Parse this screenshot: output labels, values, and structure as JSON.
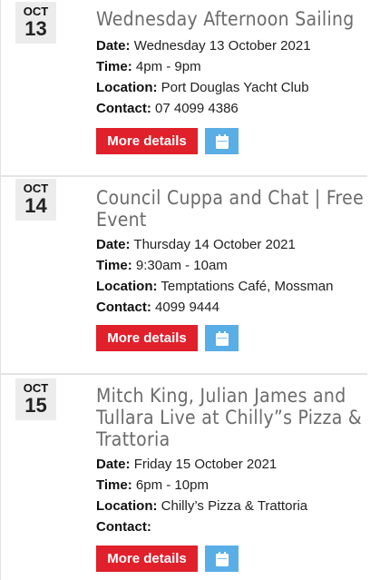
{
  "events": [
    {
      "month": "OCT",
      "day": "13",
      "title": "Wednesday Afternoon Sailing",
      "date_label": "Date:",
      "date": "Wednesday 13 October 2021",
      "time_label": "Time:",
      "time": "4pm - 9pm",
      "location_label": "Location:",
      "location": "Port Douglas Yacht Club",
      "contact_label": "Contact:",
      "contact": "07 4099 4386",
      "more_label": "More details",
      "calendar_icon": "calendar-icon"
    },
    {
      "month": "OCT",
      "day": "14",
      "title_line1": "Council Cuppa and Chat | Free",
      "title_line2": "Event",
      "date_label": "Date:",
      "date": "Thursday 14 October 2021",
      "time_label": "Time:",
      "time": "9:30am - 10am",
      "location_label": "Location:",
      "location": "Temptations Café, Mossman",
      "contact_label": "Contact:",
      "contact": "4099 9444",
      "more_label": "More details",
      "calendar_icon": "calendar-icon"
    },
    {
      "month": "OCT",
      "day": "15",
      "title_line1": "Mitch King, Julian James and",
      "title_line2": "Tullara Live at Chilly”s Pizza &",
      "title_line3": "Trattoria",
      "date_label": "Date:",
      "date": "Friday 15 October 2021",
      "time_label": "Time:",
      "time": "6pm - 10pm",
      "location_label": "Location:",
      "location": "Chilly’s Pizza & Trattoria",
      "contact_label": "Contact:",
      "contact": "",
      "more_label": "More details",
      "calendar_icon": "calendar-icon"
    }
  ],
  "colors": {
    "more_button": "#e0202b",
    "calendar_button": "#5aaee6",
    "title": "#6b6b6b",
    "date_box": "#ececec"
  }
}
